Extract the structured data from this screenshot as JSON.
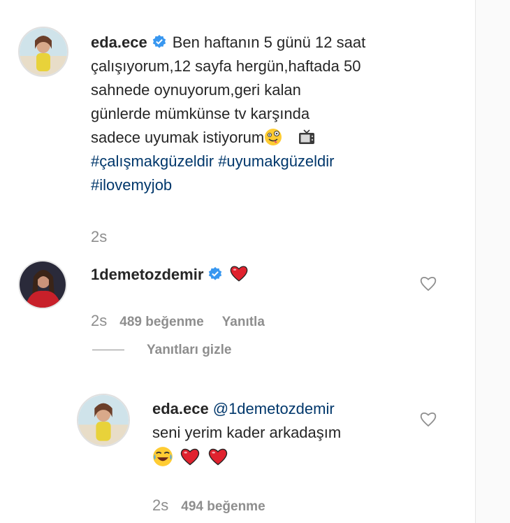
{
  "post": {
    "username": "eda.ece",
    "text_lines": [
      "Ben haftanın 5 günü 12 saat",
      "çalışıyorum,12 sayfa hergün,haftada 50",
      "sahnede oynuyorum,geri kalan",
      "günlerde mümkünse tv karşında",
      "sadece uyumak istiyorum"
    ],
    "hashtags_line1": "#çalışmakgüzeldir #uyumakgüzeldir",
    "hashtags_line2": "#ilovemyjob",
    "time": "2s"
  },
  "comment": {
    "username": "1demetozdemir",
    "time": "2s",
    "likes": "489 beğenme",
    "reply_label": "Yanıtla"
  },
  "hide_replies_label": "Yanıtları gizle",
  "reply": {
    "username": "eda.ece",
    "mention": "@1demetozdemir",
    "text": "seni yerim kader arkadaşım",
    "time": "2s",
    "likes": "494 beğenme"
  },
  "colors": {
    "verified": "#3897f0",
    "hashtag": "#00376b",
    "heart": "#ed4956",
    "meta": "#8e8e8e"
  },
  "icons": [
    "verified-badge-icon",
    "zany-face-emoji",
    "tv-emoji",
    "red-heart-emoji",
    "joy-emoji",
    "heart-outline-icon"
  ]
}
